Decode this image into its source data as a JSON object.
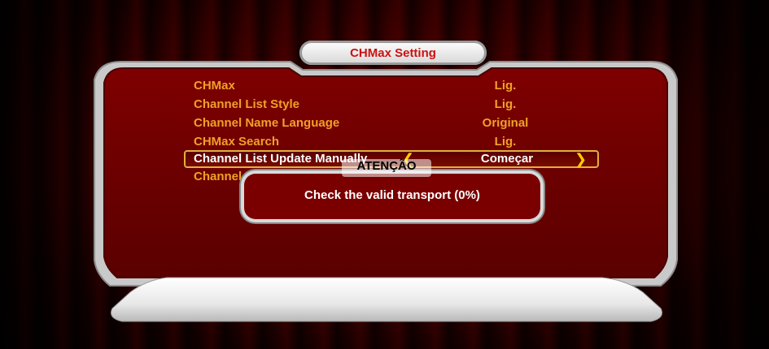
{
  "menu": {
    "title": "CHMax Setting",
    "items": [
      {
        "label": "CHMax",
        "value": "Lig."
      },
      {
        "label": "Channel List Style",
        "value": "Lig."
      },
      {
        "label": "Channel Name Language",
        "value": "Original"
      },
      {
        "label": "CHMax Search",
        "value": "Lig."
      },
      {
        "label": "Channel List Update Manually",
        "value": "Começar",
        "selected": true
      },
      {
        "label": "Channel List Update Auto",
        "value": ""
      }
    ]
  },
  "dialog": {
    "title": "ATENÇÃO",
    "message": "Check the valid transport (0%)"
  },
  "colors": {
    "item_text": "#f0a028",
    "selected_text": "#ffffff",
    "title_text": "#cc1111",
    "panel": "#6e0000",
    "arrow": "#ffcc00"
  },
  "icons": {
    "left_arrow": "chevron-left-icon",
    "right_arrow": "chevron-right-icon"
  }
}
